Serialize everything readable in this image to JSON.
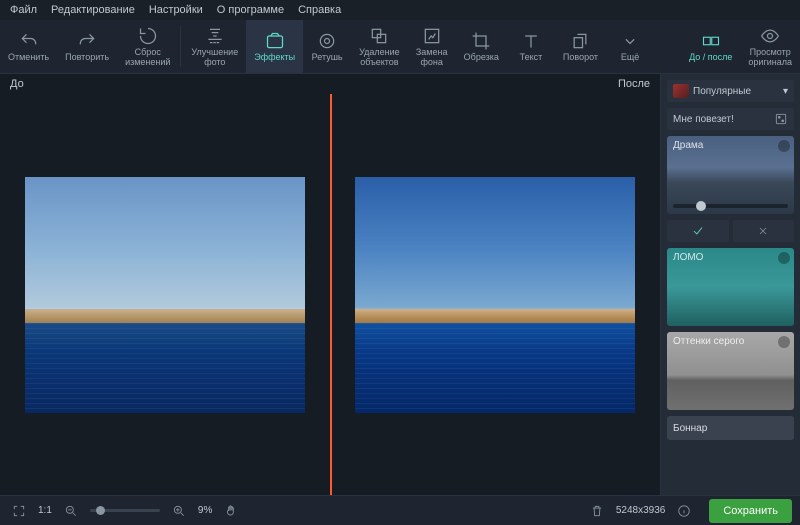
{
  "menu": {
    "file": "Файл",
    "edit": "Редактирование",
    "settings": "Настройки",
    "about": "О программе",
    "help": "Справка"
  },
  "tools": {
    "undo": "Отменить",
    "redo": "Повторить",
    "reset": "Сброс\nизменений",
    "enhance": "Улучшение\nфото",
    "effects": "Эффекты",
    "retouch": "Ретушь",
    "removeobj": "Удаление\nобъектов",
    "bgreplace": "Замена\nфона",
    "crop": "Обрезка",
    "text": "Текст",
    "rotate": "Поворот",
    "more": "Ещё",
    "beforeafter": "До / после",
    "original": "Просмотр\nоригинала"
  },
  "canvas": {
    "before": "До",
    "after": "После"
  },
  "side": {
    "popular": "Популярные",
    "lucky": "Мне повезет!",
    "drama": "Драма",
    "lomo": "ЛОМО",
    "gray": "Оттенки серого",
    "bonnar": "Боннар"
  },
  "status": {
    "scale": "1:1",
    "zoom": "9%",
    "dims": "5248x3936",
    "save": "Сохранить"
  }
}
